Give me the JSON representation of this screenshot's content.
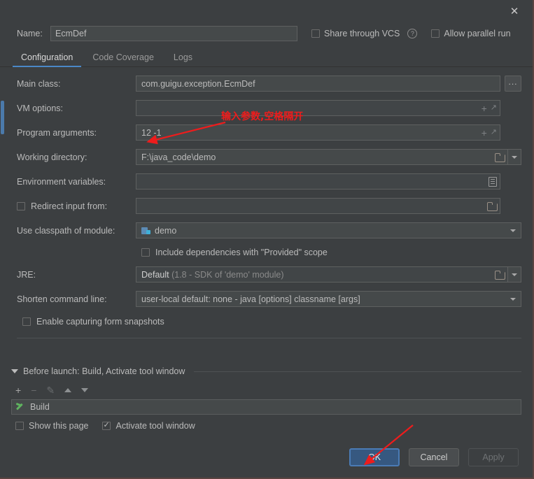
{
  "window": {
    "close_icon": "close-icon"
  },
  "header": {
    "name_label": "Name:",
    "name_value": "EcmDef",
    "share_vcs_label": "Share through VCS",
    "share_vcs_checked": false,
    "help_icon": "?",
    "allow_parallel_label": "Allow parallel run",
    "allow_parallel_checked": false
  },
  "tabs": [
    {
      "label": "Configuration",
      "active": true
    },
    {
      "label": "Code Coverage",
      "active": false
    },
    {
      "label": "Logs",
      "active": false
    }
  ],
  "form": {
    "main_class": {
      "label": "Main class:",
      "value": "com.guigu.exception.EcmDef",
      "browse_label": "..."
    },
    "vm_options": {
      "label": "VM options:",
      "value": "",
      "icons": [
        "plus-icon",
        "expand-icon"
      ]
    },
    "program_arguments": {
      "label": "Program arguments:",
      "value": "12 -1",
      "icons": [
        "plus-icon",
        "expand-icon"
      ]
    },
    "working_directory": {
      "label": "Working directory:",
      "value": "F:\\java_code\\demo"
    },
    "environment_variables": {
      "label": "Environment variables:",
      "value": ""
    },
    "redirect_input": {
      "label": "Redirect input from:",
      "checked": false,
      "value": ""
    },
    "use_classpath": {
      "label": "Use classpath of module:",
      "value": "demo"
    },
    "include_provided": {
      "label": "Include dependencies with \"Provided\" scope",
      "checked": false
    },
    "jre": {
      "label": "JRE:",
      "value_bold": "Default",
      "value_dim": "(1.8 - SDK of 'demo' module)"
    },
    "shorten_command_line": {
      "label": "Shorten command line:",
      "value_bold": "user-local default: none",
      "value_dim": "- java [options] classname [args]"
    },
    "enable_snapshots": {
      "label": "Enable capturing form snapshots",
      "checked": false
    }
  },
  "before_launch": {
    "title": "Before launch: Build, Activate tool window",
    "toolbar": [
      "add-icon",
      "remove-icon",
      "edit-icon",
      "move-up-icon",
      "move-down-icon"
    ],
    "tasks": [
      {
        "icon": "build-hammer-icon",
        "label": "Build"
      }
    ],
    "show_page_label": "Show this page",
    "show_page_checked": false,
    "activate_tool_window_label": "Activate tool window",
    "activate_tool_window_checked": true
  },
  "buttons": {
    "ok": "OK",
    "cancel": "Cancel",
    "apply": "Apply"
  },
  "annotations": {
    "note": "输入参数,空格隔开",
    "color": "#ee1c1c"
  }
}
